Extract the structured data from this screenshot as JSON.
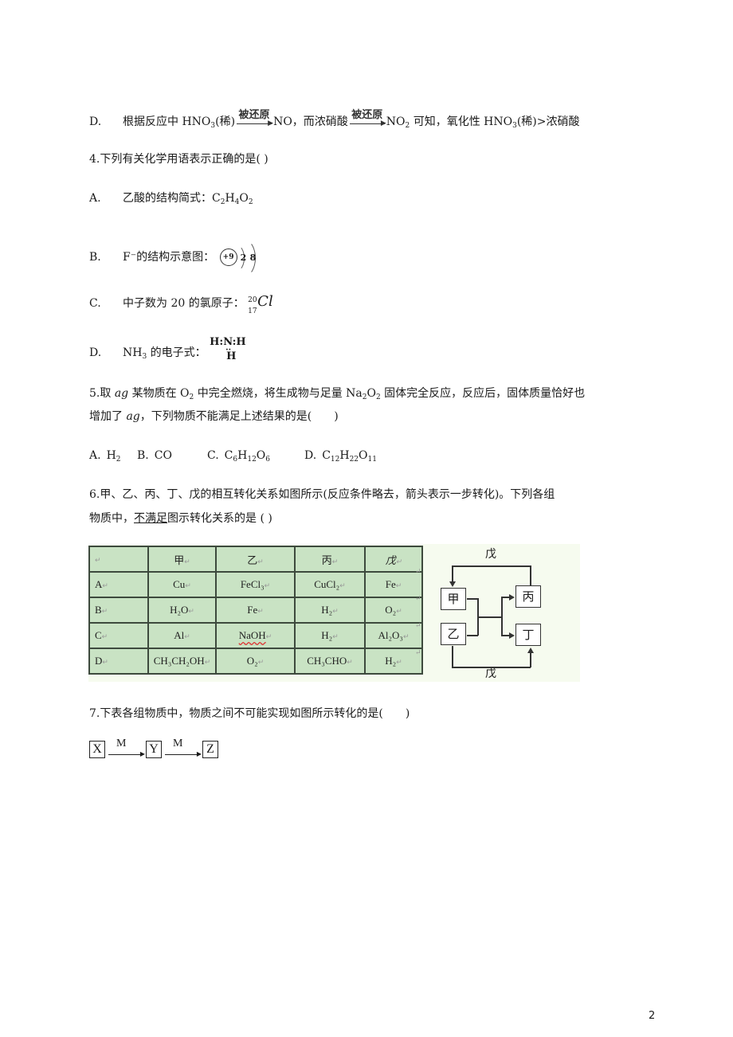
{
  "q3": {
    "option_d": {
      "label": "D.",
      "text_1": "根据反应中 HNO",
      "sub_1": "3",
      "text_2": "(稀)",
      "arrow_label_1": "被还原",
      "text_3": "NO，而浓硝酸",
      "arrow_label_2": "被还原",
      "text_4": "NO",
      "sub_4": "2",
      "text_5": " 可知，氧化性 HNO",
      "sub_5": "3",
      "text_6": "(稀)>浓硝酸"
    }
  },
  "q4": {
    "stem": "4.下列有关化学用语表示正确的是( )",
    "options": {
      "a": {
        "label": "A.",
        "text": "乙酸的结构简式：C",
        "formula_parts": [
          "2",
          "H",
          "4",
          "O",
          "2"
        ]
      },
      "b": {
        "label": "B.",
        "text": "F⁻的结构示意图：",
        "nucleus": "+9",
        "shell_electrons": [
          "2",
          "8"
        ]
      },
      "c": {
        "label": "C.",
        "text": "中子数为 20 的氯原子：",
        "mass_number": "20",
        "atomic_number": "17",
        "symbol": "Cl"
      },
      "d": {
        "label": "D.",
        "text_1": "NH",
        "sub": "3",
        "text_2": " 的电子式：",
        "eformula_top": "H:N:H",
        "eformula_dots": "··",
        "eformula_bottom": "H"
      }
    }
  },
  "q5": {
    "line_1": {
      "t1": "5.取 ",
      "italic_1": "ag",
      "t2": " 某物质在 O",
      "s1": "2",
      "t3": " 中完全燃烧，将生成物与足量 Na",
      "s2": "2",
      "t4": "O",
      "s3": "2",
      "t5": " 固体完全反应，反应后，固体质量恰好也"
    },
    "line_2": {
      "t1": "增加了 ",
      "italic_1": "ag",
      "t2": "，下列物质不能满足上述结果的是(　　)"
    },
    "options": [
      {
        "label": "A.",
        "parts": [
          [
            "H",
            ""
          ],
          [
            "2",
            "sub"
          ]
        ]
      },
      {
        "label": "B.",
        "parts": [
          [
            "CO",
            ""
          ]
        ]
      },
      {
        "label": "C.",
        "parts": [
          [
            "C",
            ""
          ],
          [
            "6",
            "sub"
          ],
          [
            "H",
            ""
          ],
          [
            "12",
            "sub"
          ],
          [
            "O",
            ""
          ],
          [
            "6",
            "sub"
          ]
        ]
      },
      {
        "label": "D.",
        "parts": [
          [
            "C",
            ""
          ],
          [
            "12",
            "sub"
          ],
          [
            "H",
            ""
          ],
          [
            "22",
            "sub"
          ],
          [
            "O",
            ""
          ],
          [
            "11",
            "sub"
          ]
        ]
      }
    ]
  },
  "q6": {
    "line_1": "6.甲、乙、丙、丁、戊的相互转化关系如图所示(反应条件略去，箭头表示一步转化)。下列各组",
    "line_2_pre": "物质中，",
    "line_2_under": "不满足",
    "line_2_post": "图示转化关系的是 ( )",
    "table": {
      "headers": [
        "",
        "甲",
        "乙",
        "丙",
        "戊"
      ],
      "rows": [
        {
          "label": "A",
          "cells": [
            "Cu",
            "FeCl₃",
            "CuCl₂",
            "Fe"
          ]
        },
        {
          "label": "B",
          "cells": [
            "H₂O",
            "Fe",
            "H₂",
            "O₂"
          ]
        },
        {
          "label": "C",
          "cells": [
            "Al",
            "NaOH",
            "H₂",
            "Al₂O₃"
          ]
        },
        {
          "label": "D",
          "cells": [
            "CH₃CH₂OH",
            "O₂",
            "CH₃CHO",
            "H₂"
          ]
        }
      ],
      "paragraph_mark": "↵",
      "background_color": "#c9e3c4"
    },
    "diagram": {
      "boxes": {
        "jia": "甲",
        "yi": "乙",
        "bing": "丙",
        "ding": "丁"
      },
      "top_label": "戊",
      "bottom_label": "戊"
    }
  },
  "q7": {
    "stem": "7.下表各组物质中，物质之间不可能实现如图所示转化的是(　　)",
    "flow": {
      "x": "X",
      "y": "Y",
      "z": "Z",
      "reagent_1": "M",
      "reagent_2": "M"
    }
  },
  "footer": {
    "page_number": "2"
  }
}
